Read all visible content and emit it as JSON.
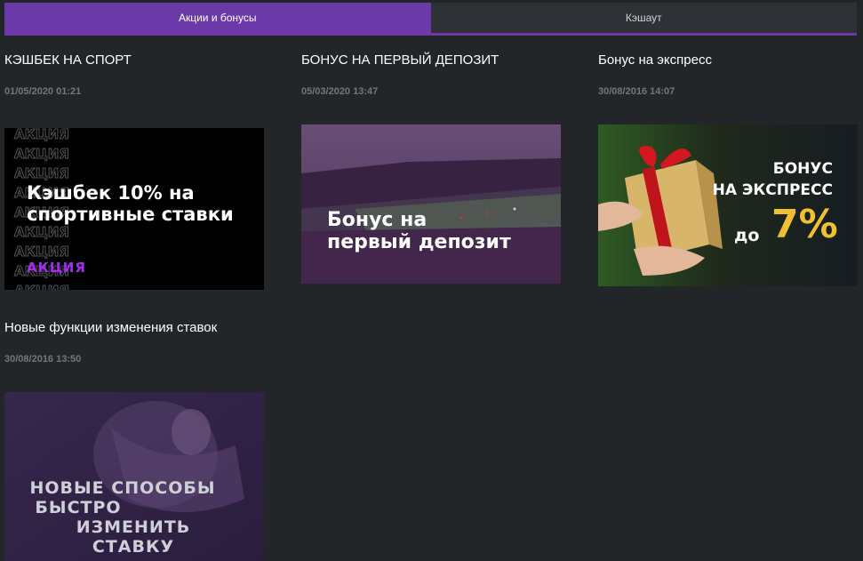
{
  "tabs": [
    {
      "label": "Акции и бонусы",
      "active": true
    },
    {
      "label": "Кэшаут",
      "active": false
    }
  ],
  "colors": {
    "accent": "#6b3aa8",
    "background": "#232629",
    "date": "#72777d"
  },
  "promos": [
    {
      "title": "КЭШБЕК НА СПОРТ",
      "date": "01/05/2020 01:21",
      "banner": {
        "headline_line1": "Кэшбек 10% на",
        "headline_line2": "спортивные ставки",
        "tag": "АКЦИЯ",
        "bg_word": "АКЦИЯ"
      }
    },
    {
      "title": "БОНУС НА ПЕРВЫЙ ДЕПОЗИТ",
      "date": "05/03/2020 13:47",
      "banner": {
        "headline_line1": "Бонус на",
        "headline_line2": "первый депозит"
      }
    },
    {
      "title": "Бонус на экспресс",
      "date": "30/08/2016 14:07",
      "banner": {
        "headline_line1": "БОНУС",
        "headline_line2": "НА ЭКСПРЕСС",
        "prefix": "до",
        "percent": "7%"
      }
    },
    {
      "title": "Новые функции изменения ставок",
      "date": "30/08/2016 13:50",
      "banner": {
        "headline_line1": "НОВЫЕ СПОСОБЫ",
        "headline_line2": "БЫСТРО",
        "headline_line3": "ИЗМЕНИТЬ СТАВКУ"
      }
    }
  ]
}
